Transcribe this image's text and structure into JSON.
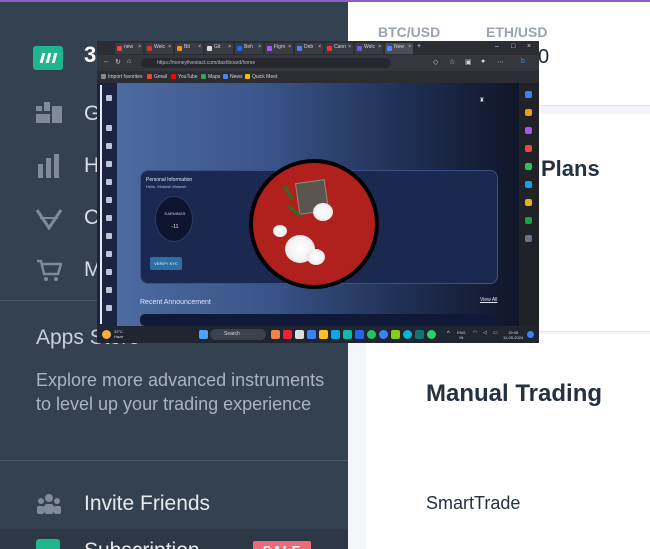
{
  "sidebar": {
    "logo_number": "3",
    "items": [
      {
        "label": "G"
      },
      {
        "label": "H"
      },
      {
        "label": "C"
      },
      {
        "label": "M"
      }
    ],
    "apps_store": {
      "title": "Apps Store",
      "description": "Explore more advanced instruments to level up your trading experience"
    },
    "invite_label": "Invite Friends",
    "subscription": {
      "label": "Subscription",
      "badge": "SALE"
    }
  },
  "ticker": {
    "btc": {
      "label": "BTC/USD",
      "value": ""
    },
    "eth": {
      "label": "ETH/USD",
      "value": "0"
    }
  },
  "main": {
    "plans_title": "Plans",
    "manual_title": "Manual Trading",
    "smarttrade_label": "SmartTrade"
  },
  "screenshot": {
    "tabs": [
      "new",
      "Welc",
      "Bit",
      "Git",
      "Beh",
      "Figm",
      "Deb",
      "Cann",
      "Welc",
      "New"
    ],
    "address": "https://moneyfivestact.com/dashboard/home",
    "bookmarks": [
      "Import favorites",
      "Gmail",
      "YouTube",
      "Maps",
      "News",
      "Quick Meet"
    ],
    "page": {
      "card_title": "Personal Information",
      "card_hello": "Hello, Mukesh Mukesh",
      "earnings_label": "EARNINGS",
      "earnings_value": "-11",
      "kyc_button": "VERIFY KYC",
      "announcement_title": "Recent Announcement",
      "view_all": "View All"
    },
    "taskbar": {
      "weather_temp": "33°C",
      "weather_desc": "Haze",
      "search": "Search",
      "lang": "ENG",
      "region": "IN",
      "time": "19:05",
      "date": "11-05-2024"
    }
  },
  "colors": {
    "sidebar_bg": "#344150",
    "accent_green": "#1fb58f",
    "sale_badge": "#e86c7a",
    "top_accent": "#8a5fbf"
  }
}
